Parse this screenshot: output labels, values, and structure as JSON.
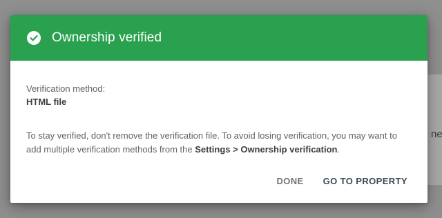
{
  "background": {
    "partial_text": "ne"
  },
  "dialog": {
    "title": "Ownership verified",
    "header_color": "#2aa14f",
    "icon": "check-circle-icon",
    "method_label": "Verification method:",
    "method_value": "HTML file",
    "message_part1": "To stay verified, don't remove the verification file. To avoid losing verification, you may want to add multiple verification methods from the ",
    "message_link": "Settings > Ownership verification",
    "message_end": ".",
    "actions": {
      "done": "DONE",
      "go_to_property": "GO TO PROPERTY"
    }
  }
}
